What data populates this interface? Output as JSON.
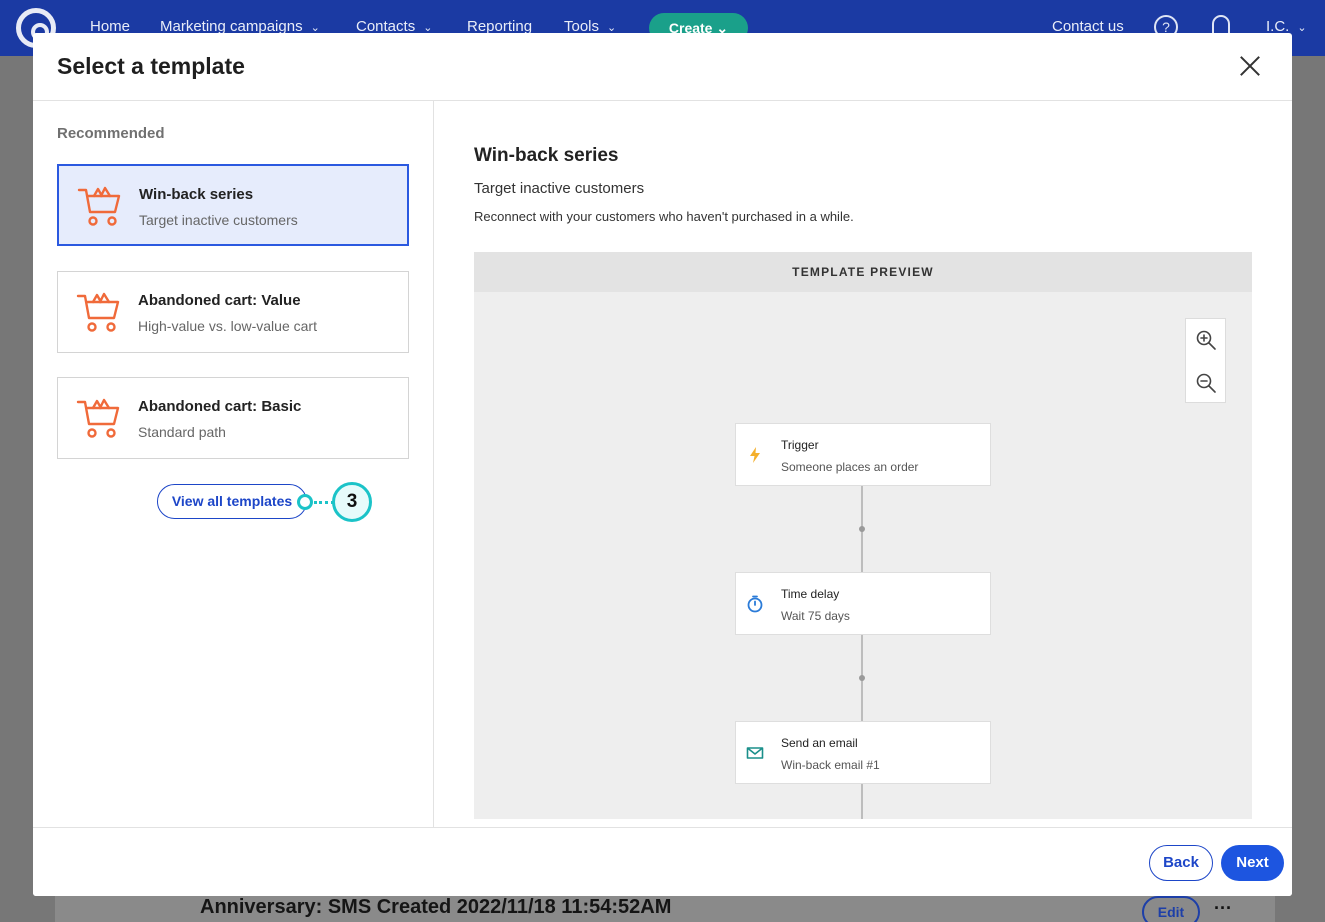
{
  "nav": {
    "items": [
      {
        "label": "Home",
        "has_menu": false
      },
      {
        "label": "Marketing campaigns",
        "has_menu": true
      },
      {
        "label": "Contacts",
        "has_menu": true
      },
      {
        "label": "Reporting",
        "has_menu": false
      },
      {
        "label": "Tools",
        "has_menu": true
      }
    ],
    "create_label": "Create",
    "contact_label": "Contact us",
    "user_initials": "I.C."
  },
  "background": {
    "row_text": "Anniversary: SMS Created 2022/11/18 11:54:52AM",
    "edit_label": "Edit",
    "more_label": "···"
  },
  "modal": {
    "title": "Select a template",
    "recommended_label": "Recommended",
    "templates": [
      {
        "name": "Win-back series",
        "desc": "Target inactive customers",
        "selected": true
      },
      {
        "name": "Abandoned cart: Value",
        "desc": "High-value vs. low-value cart",
        "selected": false
      },
      {
        "name": "Abandoned cart: Basic",
        "desc": "Standard path",
        "selected": false
      }
    ],
    "view_all_label": "View all templates",
    "callout_number": "3",
    "detail": {
      "title": "Win-back series",
      "subtitle": "Target inactive customers",
      "description": "Reconnect with your customers who haven't purchased in a while."
    },
    "preview": {
      "header": "TEMPLATE PREVIEW",
      "nodes": [
        {
          "icon": "lightning-icon",
          "title": "Trigger",
          "sub": "Someone places an order"
        },
        {
          "icon": "stopwatch-icon",
          "title": "Time delay",
          "sub": "Wait 75 days"
        },
        {
          "icon": "envelope-icon",
          "title": "Send an email",
          "sub": "Win-back email #1"
        }
      ]
    },
    "back_label": "Back",
    "next_label": "Next"
  },
  "colors": {
    "brand_nav": "#1b3aa3",
    "accent_blue": "#1d55e0",
    "cart_orange": "#f06a3a",
    "callout_teal": "#1bc3c8",
    "create_green": "#1aa08a"
  }
}
